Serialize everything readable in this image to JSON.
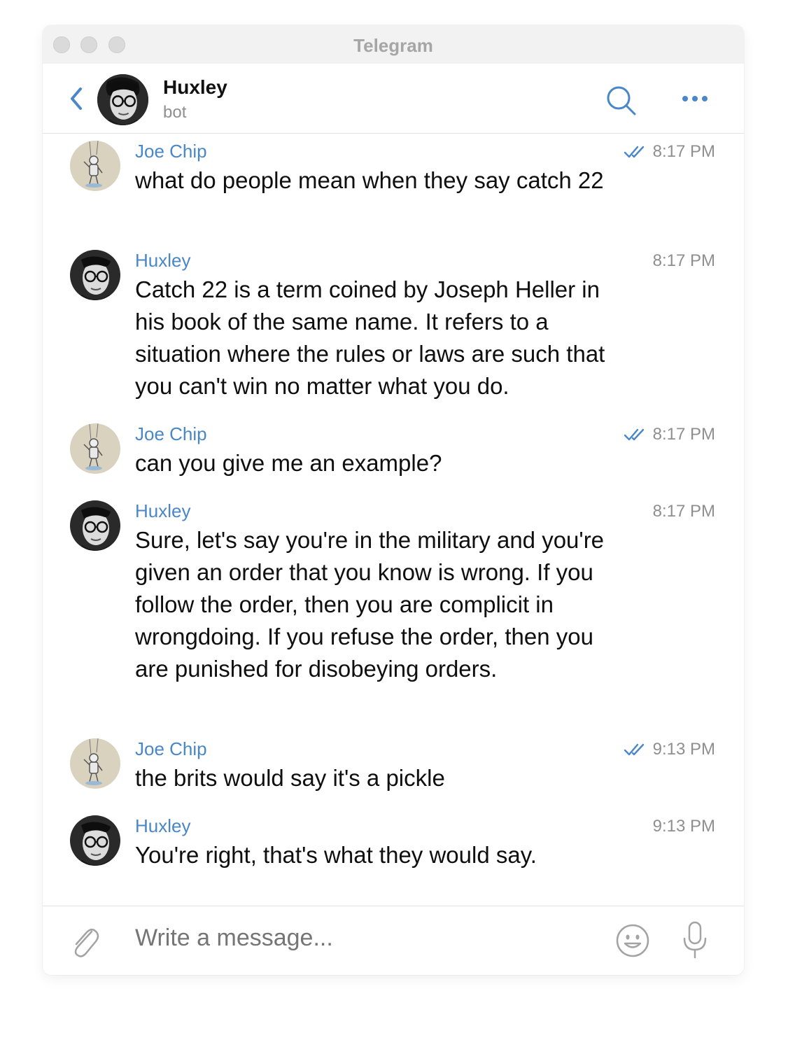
{
  "window": {
    "title": "Telegram"
  },
  "header": {
    "name": "Huxley",
    "status": "bot",
    "back_icon": "chevron-left-icon",
    "search_icon": "search-icon",
    "more_icon": "more-horizontal-icon"
  },
  "messages": [
    {
      "sender": "Joe Chip",
      "text": "what do people mean when they say catch 22",
      "time": "8:17 PM",
      "read": true,
      "avatar": "joe-chip-avatar"
    },
    {
      "sender": "Huxley",
      "text": "Catch 22 is a term coined by Joseph Heller in his book of the same name. It refers to a situation where the rules or laws are such that you can't win no matter what you do.",
      "time": "8:17 PM",
      "read": false,
      "avatar": "huxley-avatar"
    },
    {
      "sender": "Joe Chip",
      "text": "can you give me an example?",
      "time": "8:17 PM",
      "read": true,
      "avatar": "joe-chip-avatar"
    },
    {
      "sender": "Huxley",
      "text": "Sure, let's say you're in the military and you're given an order that you know is wrong. If you follow the order, then you are complicit in wrongdoing. If you refuse the order, then you are punished for disobeying orders.",
      "time": "8:17 PM",
      "read": false,
      "avatar": "huxley-avatar"
    },
    {
      "sender": "Joe Chip",
      "text": "the brits would say it's a pickle",
      "time": "9:13 PM",
      "read": true,
      "avatar": "joe-chip-avatar"
    },
    {
      "sender": "Huxley",
      "text": "You're right, that's what they would say.",
      "time": "9:13 PM",
      "read": false,
      "avatar": "huxley-avatar"
    }
  ],
  "composer": {
    "placeholder": "Write a message...",
    "attach_icon": "paperclip-icon",
    "emoji_icon": "emoji-icon",
    "mic_icon": "microphone-icon"
  },
  "colors": {
    "accent": "#4a87c9",
    "sender": "#4a87c9",
    "timestamp": "#8f8f8f",
    "titlebar": "#f2f2f2"
  }
}
